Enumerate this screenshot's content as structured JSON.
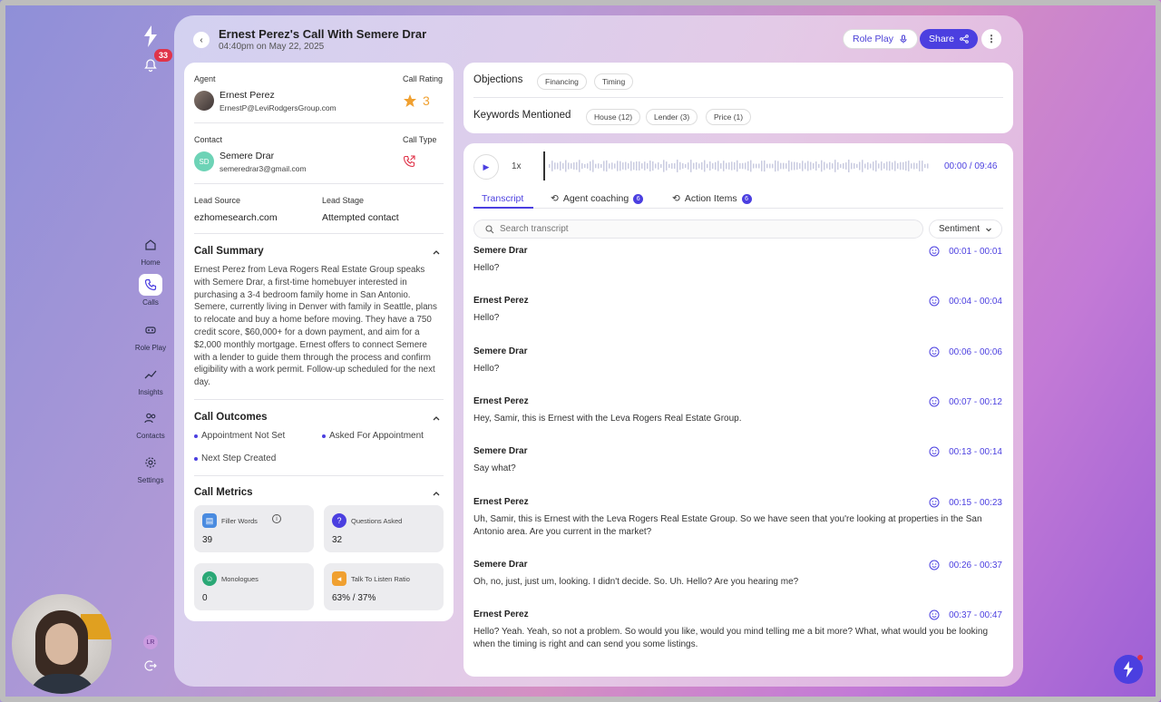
{
  "sidebar": {
    "notification_count": "33",
    "items": [
      {
        "label": "Home",
        "icon": "home-icon"
      },
      {
        "label": "Calls",
        "icon": "phone-icon"
      },
      {
        "label": "Role Play",
        "icon": "headset-icon"
      },
      {
        "label": "Insights",
        "icon": "trend-icon"
      },
      {
        "label": "Contacts",
        "icon": "users-icon"
      },
      {
        "label": "Settings",
        "icon": "gear-icon"
      }
    ],
    "user_initials": "LR"
  },
  "header": {
    "title": "Ernest Perez's Call With Semere Drar",
    "subtitle": "04:40pm on May 22, 2025",
    "role_play_label": "Role Play",
    "share_label": "Share"
  },
  "details": {
    "agent_label": "Agent",
    "agent_name": "Ernest Perez",
    "agent_email": "ErnestP@LeviRodgersGroup.com",
    "call_rating_label": "Call Rating",
    "call_rating": "3",
    "contact_label": "Contact",
    "contact_initials": "SD",
    "contact_name": "Semere Drar",
    "contact_email": "semeredrar3@gmail.com",
    "call_type_label": "Call Type",
    "lead_source_label": "Lead Source",
    "lead_source": "ezhomesearch.com",
    "lead_stage_label": "Lead Stage",
    "lead_stage": "Attempted contact"
  },
  "summary": {
    "title": "Call Summary",
    "text": "Ernest Perez from Leva Rogers Real Estate Group speaks with Semere Drar, a first-time homebuyer interested in purchasing a 3-4 bedroom family home in San Antonio. Semere, currently living in Denver with family in Seattle, plans to relocate and buy a home before moving. They have a 750 credit score, $60,000+ for a down payment, and aim for a $2,000 monthly mortgage. Ernest offers to connect Semere with a lender to guide them through the process and confirm eligibility with a work permit. Follow-up scheduled for the next day."
  },
  "outcomes": {
    "title": "Call Outcomes",
    "items": [
      "Appointment Not Set",
      "Asked For Appointment",
      "Next Step Created"
    ]
  },
  "metrics": {
    "title": "Call Metrics",
    "items": [
      {
        "label": "Filler Words",
        "value": "39",
        "color": "#4a8be0"
      },
      {
        "label": "Questions Asked",
        "value": "32",
        "color": "#4b3fe0"
      },
      {
        "label": "Monologues",
        "value": "0",
        "color": "#2aa876"
      },
      {
        "label": "Talk To Listen Ratio",
        "value": "63% / 37%",
        "color": "#f0a030"
      }
    ]
  },
  "objections": {
    "label": "Objections",
    "chips": [
      "Financing",
      "Timing"
    ]
  },
  "keywords": {
    "label": "Keywords Mentioned",
    "chips": [
      "House (12)",
      "Lender (3)",
      "Price (1)"
    ]
  },
  "player": {
    "speed": "1x",
    "time": "00:00 / 09:46"
  },
  "tabs": [
    {
      "label": "Transcript"
    },
    {
      "label": "Agent coaching",
      "count": "6"
    },
    {
      "label": "Action Items",
      "count": "6"
    }
  ],
  "transcript": {
    "search_placeholder": "Search transcript",
    "sentiment_label": "Sentiment",
    "entries": [
      {
        "speaker": "Semere Drar",
        "time": "00:01 - 00:01",
        "text": "Hello?"
      },
      {
        "speaker": "Ernest Perez",
        "time": "00:04 - 00:04",
        "text": "Hello?"
      },
      {
        "speaker": "Semere Drar",
        "time": "00:06 - 00:06",
        "text": "Hello?"
      },
      {
        "speaker": "Ernest Perez",
        "time": "00:07 - 00:12",
        "text": "Hey, Samir, this is Ernest with the Leva Rogers Real Estate Group."
      },
      {
        "speaker": "Semere Drar",
        "time": "00:13 - 00:14",
        "text": "Say what?"
      },
      {
        "speaker": "Ernest Perez",
        "time": "00:15 - 00:23",
        "text": "Uh, Samir, this is Ernest with the Leva Rogers Real Estate Group. So we have seen that you're looking at properties in the San Antonio area. Are you current in the market?"
      },
      {
        "speaker": "Semere Drar",
        "time": "00:26 - 00:37",
        "text": "Oh, no, just, just um, looking. I didn't decide. So. Uh. Hello? Are you hearing me?"
      },
      {
        "speaker": "Ernest Perez",
        "time": "00:37 - 00:47",
        "text": "Hello? Yeah. Yeah, so not a problem. So would you like, would you mind telling me a bit more? What, what would you be looking when the timing is right and can send you some listings."
      }
    ]
  }
}
